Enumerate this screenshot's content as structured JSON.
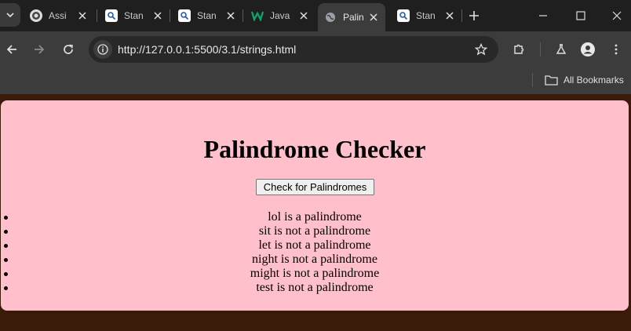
{
  "browser": {
    "tabs": [
      {
        "title": "Assi",
        "icon": "assignment-logo-icon",
        "active": false
      },
      {
        "title": "Stan",
        "icon": "search-doc-icon",
        "active": false
      },
      {
        "title": "Stan",
        "icon": "search-doc-icon",
        "active": false
      },
      {
        "title": "Java",
        "icon": "w-logo-icon",
        "active": false
      },
      {
        "title": "Palin",
        "icon": "globe-icon",
        "active": true
      },
      {
        "title": "Stan",
        "icon": "search-doc-icon",
        "active": false
      }
    ],
    "url": "http://127.0.0.1:5500/3.1/strings.html",
    "bookmarks_label": "All Bookmarks"
  },
  "page": {
    "title": "Palindrome Checker",
    "button_label": "Check for Palindromes",
    "background": "#ffc0cb",
    "results": [
      "lol is a palindrome",
      "sit is not a palindrome",
      "let is not a palindrome",
      "night is not a palindrome",
      "might is not a palindrome",
      "test is not a palindrome"
    ]
  }
}
